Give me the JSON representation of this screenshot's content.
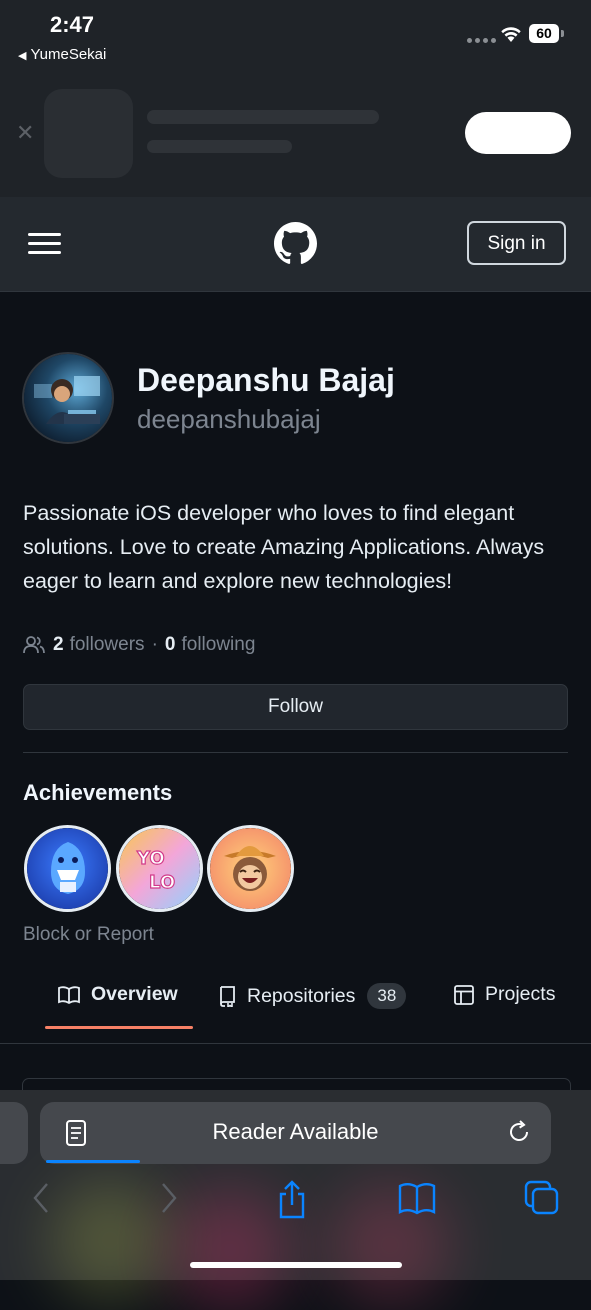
{
  "status_bar": {
    "time": "2:47",
    "back_app": "YumeSekai",
    "battery": "60"
  },
  "header": {
    "sign_in_label": "Sign in"
  },
  "profile": {
    "name": "Deepanshu Bajaj",
    "username": "deepanshubajaj",
    "bio": "Passionate iOS developer who loves to find elegant solutions. Love to create Amazing Applications. Always eager to learn and explore new technologies!",
    "followers_count": "2",
    "followers_label": "followers",
    "separator": "·",
    "following_count": "0",
    "following_label": "following",
    "follow_button": "Follow"
  },
  "achievements": {
    "title": "Achievements",
    "badges": [
      {
        "name": "shark-badge",
        "colors": [
          "#1d3fae",
          "#3b7bff"
        ]
      },
      {
        "name": "yolo-badge",
        "colors": [
          "#f3a6d8",
          "#8fd3ff"
        ]
      },
      {
        "name": "cowboy-badge",
        "colors": [
          "#f8b33c",
          "#f48b6a"
        ]
      }
    ],
    "block_report": "Block or Report"
  },
  "tabs": [
    {
      "label": "Overview",
      "icon": "book-icon",
      "active": true
    },
    {
      "label": "Repositories",
      "icon": "repo-icon",
      "count": "38"
    },
    {
      "label": "Projects",
      "icon": "table-icon"
    }
  ],
  "browser": {
    "address_text": "Reader Available",
    "progress": 0.19
  },
  "colors": {
    "background": "#0d1117",
    "header": "#24292f",
    "accent_underline": "#f78166",
    "safari_blue": "#0a84ff"
  }
}
